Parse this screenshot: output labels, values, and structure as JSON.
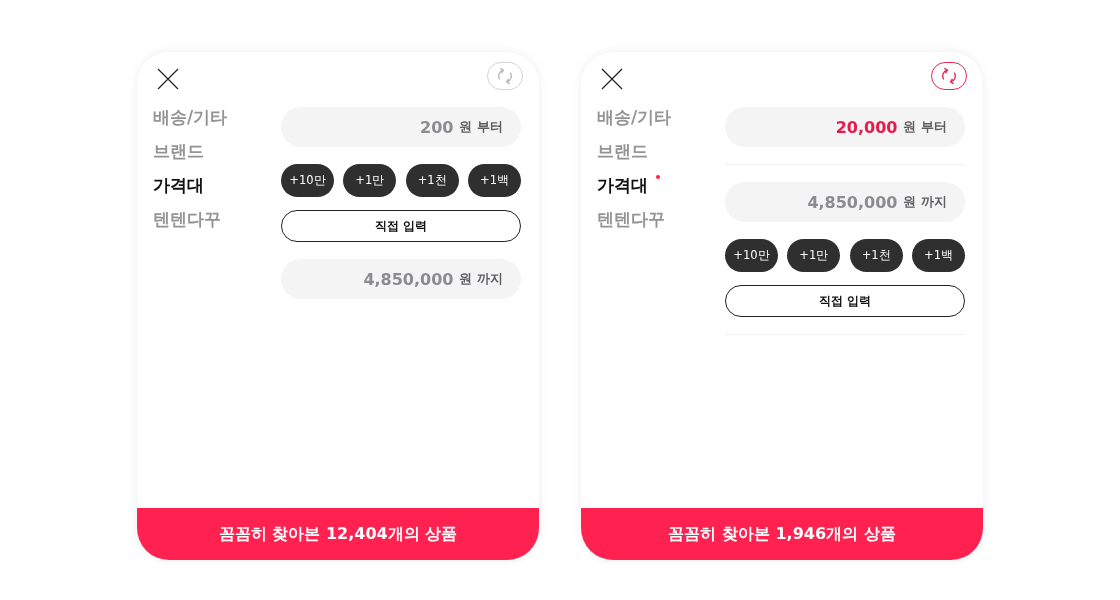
{
  "panels": [
    {
      "reset_active": false,
      "categories": [
        {
          "label": "배송/기타",
          "selected": false,
          "modified": false
        },
        {
          "label": "브랜드",
          "selected": false,
          "modified": false
        },
        {
          "label": "가격대",
          "selected": true,
          "modified": false
        },
        {
          "label": "텐텐다꾸",
          "selected": false,
          "modified": false
        }
      ],
      "sections": [
        {
          "kind": "field",
          "placeholder": "200",
          "unit": "원 부터"
        },
        {
          "kind": "steps",
          "buttons": [
            "+10만",
            "+1만",
            "+1천",
            "+1백"
          ]
        },
        {
          "kind": "button",
          "label": "직접 입력"
        },
        {
          "kind": "field",
          "placeholder": "4,850,000",
          "unit": "원 까지"
        }
      ],
      "result_button": "꼼꼼히 찾아본 12,404개의 상품"
    },
    {
      "reset_active": true,
      "categories": [
        {
          "label": "배송/기타",
          "selected": false,
          "modified": false
        },
        {
          "label": "브랜드",
          "selected": false,
          "modified": false
        },
        {
          "label": "가격대",
          "selected": true,
          "modified": true
        },
        {
          "label": "텐텐다꾸",
          "selected": false,
          "modified": false
        }
      ],
      "sections": [
        {
          "kind": "field",
          "value": "20,000",
          "unit": "원 부터"
        },
        {
          "kind": "divider"
        },
        {
          "kind": "field",
          "placeholder": "4,850,000",
          "unit": "원 까지"
        },
        {
          "kind": "steps",
          "buttons": [
            "+10만",
            "+1만",
            "+1천",
            "+1백"
          ]
        },
        {
          "kind": "button",
          "label": "직접 입력"
        },
        {
          "kind": "divider"
        }
      ],
      "result_button": "꼼꼼히 찾아본 1,946개의 상품"
    }
  ]
}
